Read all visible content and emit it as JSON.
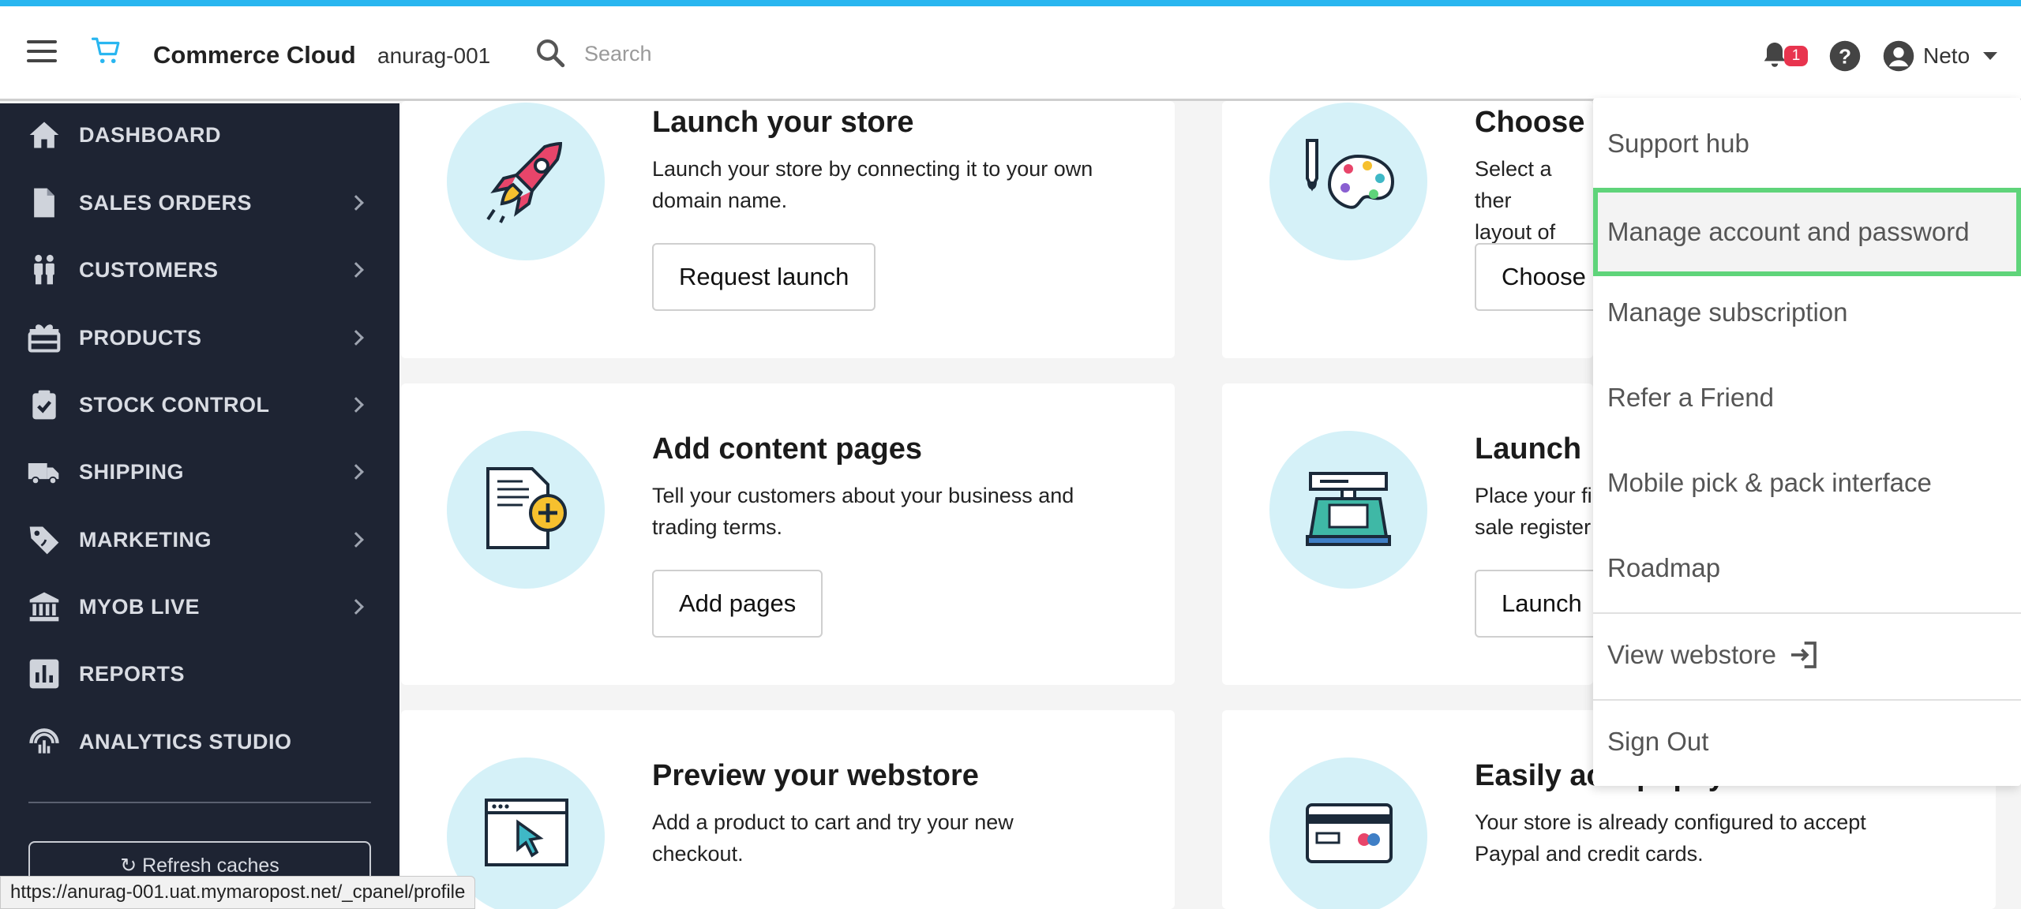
{
  "header": {
    "app_title": "Commerce Cloud",
    "store_name": "anurag-001",
    "search_placeholder": "Search",
    "notification_count": "1",
    "user_name": "Neto",
    "accent_color": "#29b6f0"
  },
  "sidebar": {
    "items": [
      {
        "label": "DASHBOARD",
        "icon": "home-icon"
      },
      {
        "label": "SALES ORDERS",
        "icon": "document-icon"
      },
      {
        "label": "CUSTOMERS",
        "icon": "people-icon"
      },
      {
        "label": "PRODUCTS",
        "icon": "gift-icon"
      },
      {
        "label": "STOCK CONTROL",
        "icon": "clipboard-check-icon"
      },
      {
        "label": "SHIPPING",
        "icon": "truck-icon"
      },
      {
        "label": "MARKETING",
        "icon": "tag-icon"
      },
      {
        "label": "MYOB LIVE",
        "icon": "bank-icon"
      },
      {
        "label": "REPORTS",
        "icon": "bar-chart-icon"
      },
      {
        "label": "ANALYTICS STUDIO",
        "icon": "analytics-icon"
      }
    ],
    "refresh_label": "Refresh caches"
  },
  "cards": {
    "launch_store": {
      "title": "Launch your store",
      "desc_1": "Launch your store by connecting it to your own",
      "desc_2": "domain name.",
      "button": "Request launch"
    },
    "choose_theme": {
      "title": "Choose",
      "desc_1": "Select a ther",
      "desc_2": "layout of you",
      "button": "Choose"
    },
    "content_pages": {
      "title": "Add content pages",
      "desc_1": "Tell your customers about your business and",
      "desc_2": "trading terms.",
      "button": "Add pages"
    },
    "launch_pos": {
      "title": "Launch",
      "desc_1": "Place your fi",
      "desc_2": "sale register",
      "button": "Launch"
    },
    "preview_webstore": {
      "title": "Preview your webstore",
      "desc_1": "Add a product to cart and try your new",
      "desc_2": "checkout."
    },
    "accept_payments": {
      "title": "Easily accept payments",
      "desc_1": "Your store is already configured to accept",
      "desc_2": "Paypal and credit cards."
    }
  },
  "user_menu": {
    "items": [
      "Support hub",
      "Manage account and password",
      "Manage subscription",
      "Refer a Friend",
      "Mobile pick & pack interface",
      "Roadmap"
    ],
    "view_webstore": "View webstore",
    "sign_out": "Sign Out",
    "highlight_color": "#5fd47a"
  },
  "status_bar": {
    "url": "https://anurag-001.uat.mymaropost.net/_cpanel/profile"
  }
}
